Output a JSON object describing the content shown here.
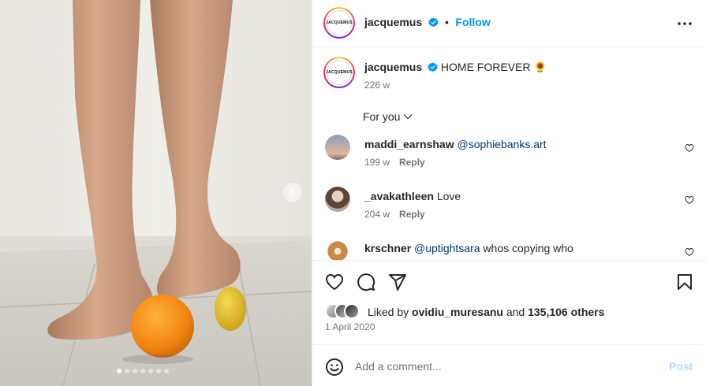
{
  "post": {
    "account": {
      "username": "jacquemus",
      "avatar_text": "JACQUEMUS",
      "verified": true,
      "follow_label": "Follow",
      "separator": "•"
    },
    "caption": {
      "username": "jacquemus",
      "text": "HOME FOREVER 🌻",
      "time": "226 w"
    },
    "comment_filter": "For you",
    "comments": [
      {
        "username": "maddi_earnshaw",
        "mention": "@sophiebanks.art",
        "text": "",
        "time": "199 w",
        "reply_label": "Reply"
      },
      {
        "username": "_avakathleen",
        "mention": "",
        "text": "Love",
        "time": "204 w",
        "reply_label": "Reply"
      },
      {
        "username": "krschner",
        "mention": "@uptightsara",
        "text": "whos copying who",
        "time": "",
        "reply_label": ""
      }
    ],
    "likes": {
      "prefix": "Liked by",
      "first_user": "ovidiu_muresanu",
      "connector": "and",
      "others": "135,106 others"
    },
    "date": "1 April 2020",
    "composer": {
      "placeholder": "Add a comment...",
      "post_label": "Post"
    },
    "carousel": {
      "slide_count": 7,
      "active_index": 0
    }
  },
  "icons": [
    "verified-badge-icon",
    "more-options-icon",
    "chevron-down-icon",
    "heart-icon",
    "comment-icon",
    "share-icon",
    "bookmark-icon",
    "emoji-icon",
    "chevron-right-icon"
  ],
  "colors": {
    "accent": "#0095f6",
    "post_button_disabled": "#b3dbff",
    "secondary_text": "#737373",
    "mention": "#00376b",
    "divider": "#efefef"
  }
}
